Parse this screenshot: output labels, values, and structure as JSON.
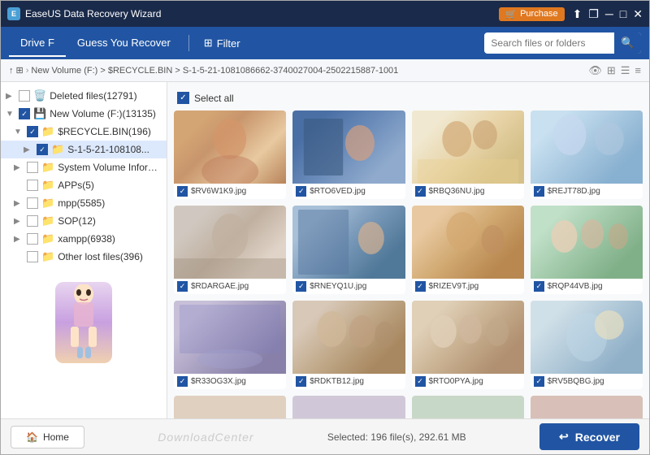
{
  "titleBar": {
    "appName": "EaseUS Data Recovery Wizard",
    "purchaseLabel": "Purchase"
  },
  "navBar": {
    "tabs": [
      {
        "id": "driveF",
        "label": "Drive F"
      },
      {
        "id": "guessRecover",
        "label": "Guess You Recover"
      }
    ],
    "filterLabel": "Filter",
    "searchPlaceholder": "Search files or folders"
  },
  "breadcrumb": {
    "path": "New Volume (F:) > $RECYCLE.BIN > S-1-5-21-1081086662-3740027004-2502215887-1001"
  },
  "sidebar": {
    "items": [
      {
        "id": "deleted",
        "label": "Deleted files(12791)",
        "level": 0,
        "checked": false,
        "icon": "🗑️",
        "expanded": false
      },
      {
        "id": "newvolume",
        "label": "New Volume (F:)(13135)",
        "level": 0,
        "checked": true,
        "icon": "💾",
        "expanded": true
      },
      {
        "id": "recycle",
        "label": "$RECYCLE.BIN(196)",
        "level": 1,
        "checked": true,
        "icon": "📁",
        "expanded": true
      },
      {
        "id": "s1",
        "label": "S-1-5-21-108108...",
        "level": 2,
        "checked": true,
        "icon": "📁",
        "expanded": false
      },
      {
        "id": "sysvolinfo",
        "label": "System Volume Informa...",
        "level": 1,
        "checked": false,
        "icon": "📁",
        "expanded": false
      },
      {
        "id": "apps",
        "label": "APPs(5)",
        "level": 1,
        "checked": false,
        "icon": "📁",
        "expanded": false
      },
      {
        "id": "mpp",
        "label": "mpp(5585)",
        "level": 1,
        "checked": false,
        "icon": "📁",
        "expanded": false
      },
      {
        "id": "sop",
        "label": "SOP(12)",
        "level": 1,
        "checked": false,
        "icon": "📁",
        "expanded": false
      },
      {
        "id": "xampp",
        "label": "xampp(6938)",
        "level": 1,
        "checked": false,
        "icon": "📁",
        "expanded": false
      },
      {
        "id": "otherlost",
        "label": "Other lost files(396)",
        "level": 1,
        "checked": false,
        "icon": "📁",
        "expanded": false
      }
    ]
  },
  "gallery": {
    "selectAllLabel": "Select all",
    "items": [
      {
        "id": "1",
        "name": "$RV6W1K9.jpg",
        "imgClass": "img-1"
      },
      {
        "id": "2",
        "name": "$RTO6VED.jpg",
        "imgClass": "img-2"
      },
      {
        "id": "3",
        "name": "$RBQ36NU.jpg",
        "imgClass": "img-3"
      },
      {
        "id": "4",
        "name": "$REJT78D.jpg",
        "imgClass": "img-4"
      },
      {
        "id": "5",
        "name": "$RDARGAE.jpg",
        "imgClass": "img-5"
      },
      {
        "id": "6",
        "name": "$RNEYQ1U.jpg",
        "imgClass": "img-6"
      },
      {
        "id": "7",
        "name": "$RIZEV9T.jpg",
        "imgClass": "img-7"
      },
      {
        "id": "8",
        "name": "$RQP44VB.jpg",
        "imgClass": "img-8"
      },
      {
        "id": "9",
        "name": "$R33OG3X.jpg",
        "imgClass": "img-9"
      },
      {
        "id": "10",
        "name": "$RDKTB12.jpg",
        "imgClass": "img-10"
      },
      {
        "id": "11",
        "name": "$RTO0PYA.jpg",
        "imgClass": "img-11"
      },
      {
        "id": "12",
        "name": "$RV5BQBG.jpg",
        "imgClass": "img-12"
      }
    ]
  },
  "statusBar": {
    "homeLabel": "Home",
    "watermark": "DownloadCenter",
    "selectedText": "Selected: 196 file(s), 292.61 MB",
    "recoverLabel": "Recover"
  }
}
